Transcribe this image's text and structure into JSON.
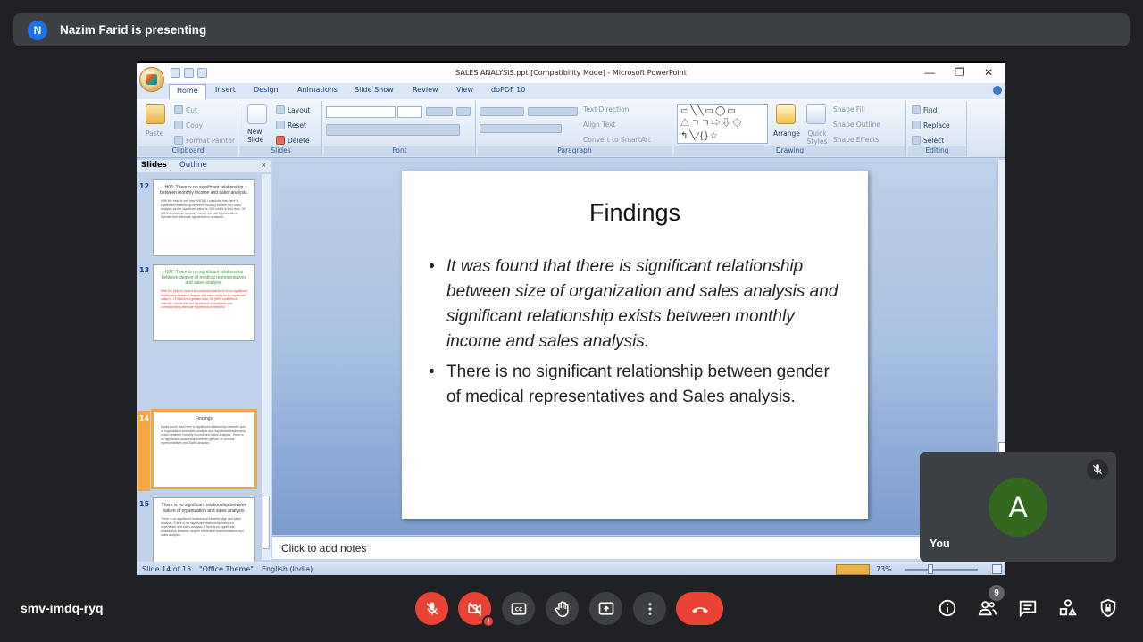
{
  "presenter": {
    "initial": "N",
    "text": "Nazim Farid is presenting"
  },
  "ppt": {
    "window_title": "SALES ANALYSIS.ppt [Compatibility Mode] - Microsoft PowerPoint",
    "tabs": [
      "Home",
      "Insert",
      "Design",
      "Animations",
      "Slide Show",
      "Review",
      "View",
      "doPDF 10"
    ],
    "ribbon": {
      "clipboard": {
        "label": "Clipboard",
        "paste": "Paste",
        "cut": "Cut",
        "copy": "Copy",
        "format_painter": "Format Painter"
      },
      "slides": {
        "label": "Slides",
        "new_slide": "New Slide",
        "layout": "Layout",
        "reset": "Reset",
        "delete": "Delete"
      },
      "font": {
        "label": "Font"
      },
      "paragraph": {
        "label": "Paragraph",
        "text_direction": "Text Direction",
        "align_text": "Align Text",
        "convert_smartart": "Convert to SmartArt"
      },
      "drawing": {
        "label": "Drawing",
        "arrange": "Arrange",
        "quick_styles": "Quick Styles",
        "shape_fill": "Shape Fill",
        "shape_outline": "Shape Outline",
        "shape_effects": "Shape Effects"
      },
      "editing": {
        "label": "Editing",
        "find": "Find",
        "replace": "Replace",
        "select": "Select"
      }
    },
    "left_pane": {
      "tabs": [
        "Slides",
        "Outline"
      ],
      "thumbs": [
        {
          "num": "12",
          "title": "H06: There is no significant relationship between monthly income and sales analysis.",
          "body": "With the help of one way ANOVA I conclude that there is significant relationship between monthly income and sales analysis as the significant value is .000 which is less than .05 (95% confidence interval). Hence the null hypothesis is rejected and alternate hypothesis is accepted."
        },
        {
          "num": "13",
          "title": "H07: There is no significant relationship between degree of medical representatives and sales analysis.",
          "body": "With the help of t-test it is concluded that there is no significant relationship between degree and sales analysis as significant value is .719 which is greater than .05 (95% confidence interval). Hence the null hypothesis is accepted and corresponding alternate hypothesis is rejected."
        },
        {
          "num": "14",
          "title": "Findings",
          "body": "It was found that there is significant relationship between size of organization and sales analysis and significant relationship exists between monthly income and sales analysis. There is no significant relationship between gender of medical representatives and Sales analysis."
        },
        {
          "num": "15",
          "title": "There is no significant relationship between nature of organization and sales analysis.",
          "body": "There is no significant relationship between age and sales analysis. There is no significant relationship between experience and sales analysis. There is no significant relationship between degree of medical representatives and sales analysis."
        }
      ]
    },
    "slide": {
      "title": "Findings",
      "bullet1": "It was found that there is significant relationship between size of organization and sales analysis and significant relationship exists between monthly income and sales analysis.",
      "bullet2": "There is no significant relationship between gender of medical representatives and Sales analysis."
    },
    "notes_placeholder": "Click to add notes",
    "status": {
      "slide": "Slide 14 of 15",
      "theme": "\"Office Theme\"",
      "language": "English (India)",
      "zoom": "73%"
    }
  },
  "self_tile": {
    "initial": "A",
    "name": "You"
  },
  "meeting": {
    "code": "smv-imdq-ryq",
    "participants_count": "9"
  },
  "colors": {
    "accent_red": "#ea4335",
    "avatar_blue": "#1a73e8",
    "avatar_green": "#33691e"
  }
}
